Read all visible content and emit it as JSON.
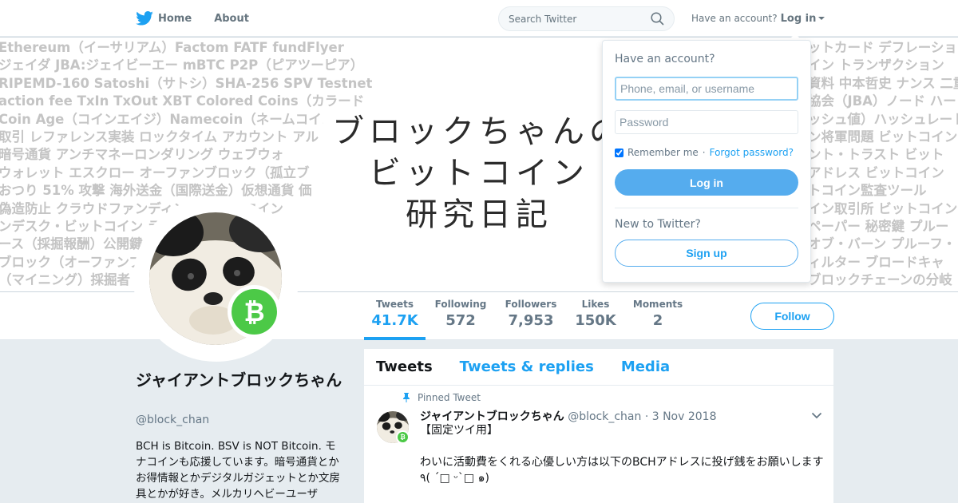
{
  "topnav": {
    "home_label": "Home",
    "about_label": "About",
    "search_placeholder": "Search Twitter",
    "have_account": "Have an account?",
    "login_label": "Log in"
  },
  "banner": {
    "background_lines": [
      "Ethereum（イーサリアム）Factom FATF fundFlyer",
      "ジェイダ JBA:ジェイビーエー mBTC P2P（ピアツーピア）",
      "RIPEMD-160 Satoshi（サトシ）SHA-256 SPV Testnet",
      "action fee TxIn TxOut XBT Colored Coins（カラード",
      "Coin Age（コインエイジ）Namecoin（ネームコイン）",
      "取引 レファレンス実装 ロックタイム アカウント アル",
      "暗号通貨 アンチマネーロンダリング ウェブウォ",
      "ウォレット エスクロー オーファンブロック（孤立ブ",
      "おつり 51% 攻撃 海外送金（国際送金）仮想通貨 価",
      "偽造防止 クラウドファンディング ライトコイン",
      "ンデスク・ビットコイン ラスコ",
      "ース（採掘報酬）公開鍵 トレー",
      "ブロック（オーファンブロ ゴリズ",
      "（マイニング）採掘者（マイ ウレート）"
    ],
    "background_lines_right": [
      "ットカード デフレーショ",
      "イン トランザクション",
      "資料 中本哲史 ナンス 二重",
      "協会（JBA）ノード ハー",
      "ッシュ値）ハッシュレート",
      "ン将軍問題 ビットコイン",
      "ント・トラスト ビット",
      "アドレス ビットコイン",
      "トコイン監査ツール",
      "イン取引所 ビットコイン",
      "ペーパー 秘密鍵 プルー",
      "オブ・バーン プルーフ・",
      "ィルター ブロードキャ",
      "ブロックチェーンの分岐"
    ],
    "title_lines": [
      "ブロックちゃんの",
      "ビットコイン",
      "研究日記"
    ]
  },
  "stats": [
    {
      "label": "Tweets",
      "value": "41.7K"
    },
    {
      "label": "Following",
      "value": "572"
    },
    {
      "label": "Followers",
      "value": "7,953"
    },
    {
      "label": "Likes",
      "value": "150K"
    },
    {
      "label": "Moments",
      "value": "2"
    }
  ],
  "follow_label": "Follow",
  "badge_symbol": "₿",
  "profile": {
    "name": "ジャイアントブロックちゃん",
    "handle": "@block_chan",
    "bio": "BCH is Bitcoin. BSV is NOT Bitcoin. モナコインも応援しています。暗号通貨とかお得情報とかデジタルガジェットとか文房具とかが好き。メルカリヘビーユーザ"
  },
  "timeline": {
    "tabs": [
      "Tweets",
      "Tweets & replies",
      "Media"
    ],
    "pinned_label": "Pinned Tweet",
    "tweet": {
      "author": "ジャイアントブロックちゃん",
      "handle": "@block_chan",
      "date": "· 3 Nov 2018",
      "line1": "【固定ツイ用】",
      "line2": "わいに活動費をくれる心優しい方は以下のBCHアドレスに投げ銭をお願いします",
      "line3": "٩(  ´□ ᵕ`□ ๑)"
    }
  },
  "login_dropdown": {
    "heading": "Have an account?",
    "username_placeholder": "Phone, email, or username",
    "password_placeholder": "Password",
    "remember_label": "Remember me",
    "separator": "·",
    "forgot_label": "Forgot password?",
    "login_button": "Log in",
    "new_label": "New to Twitter?",
    "signup_button": "Sign up"
  },
  "colors": {
    "accent": "#1da1f2",
    "login_button": "#55acee",
    "bch_green": "#4cc947"
  }
}
